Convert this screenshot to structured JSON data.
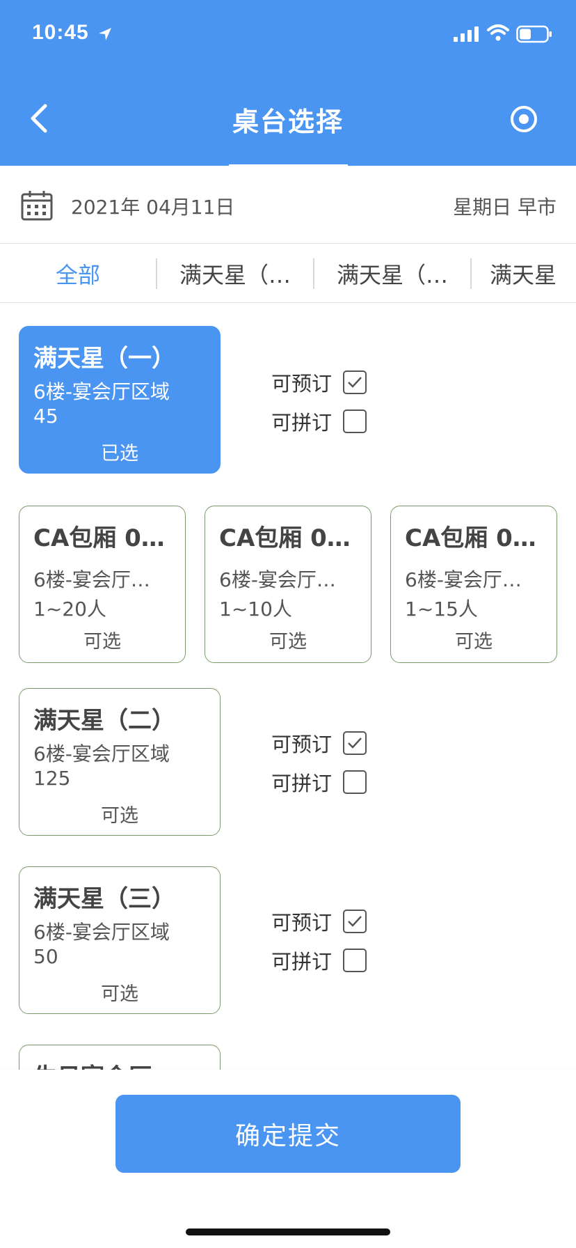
{
  "status_bar": {
    "time": "10:45"
  },
  "header": {
    "title": "桌台选择"
  },
  "date_bar": {
    "date": "2021年 04月11日",
    "weekday_session": "星期日 早市"
  },
  "tabs": [
    {
      "label": "全部"
    },
    {
      "label": "满天星（…"
    },
    {
      "label": "满天星（…"
    },
    {
      "label": "满天星"
    }
  ],
  "options": {
    "reservable": "可预订",
    "shareable": "可拼订"
  },
  "tables": [
    {
      "name": "满天星（一）",
      "area": "6楼-宴会厅区域",
      "capacity": "45",
      "state": "已选",
      "reservable": true,
      "shareable": false
    },
    {
      "name": "CA包厢 0…",
      "area": "6楼-宴会厅…",
      "capacity": "1~20人",
      "state": "可选"
    },
    {
      "name": "CA包厢 0…",
      "area": "6楼-宴会厅…",
      "capacity": "1~10人",
      "state": "可选"
    },
    {
      "name": "CA包厢 0…",
      "area": "6楼-宴会厅…",
      "capacity": "1~15人",
      "state": "可选"
    },
    {
      "name": "满天星（二）",
      "area": "6楼-宴会厅区域",
      "capacity": "125",
      "state": "可选",
      "reservable": true,
      "shareable": false
    },
    {
      "name": "满天星（三）",
      "area": "6楼-宴会厅区域",
      "capacity": "50",
      "state": "可选",
      "reservable": true,
      "shareable": false
    },
    {
      "name": "生日宴会厅"
    }
  ],
  "submit": {
    "label": "确定提交"
  },
  "colors": {
    "primary": "#4a94f2",
    "card_border": "#7a9a6a"
  }
}
